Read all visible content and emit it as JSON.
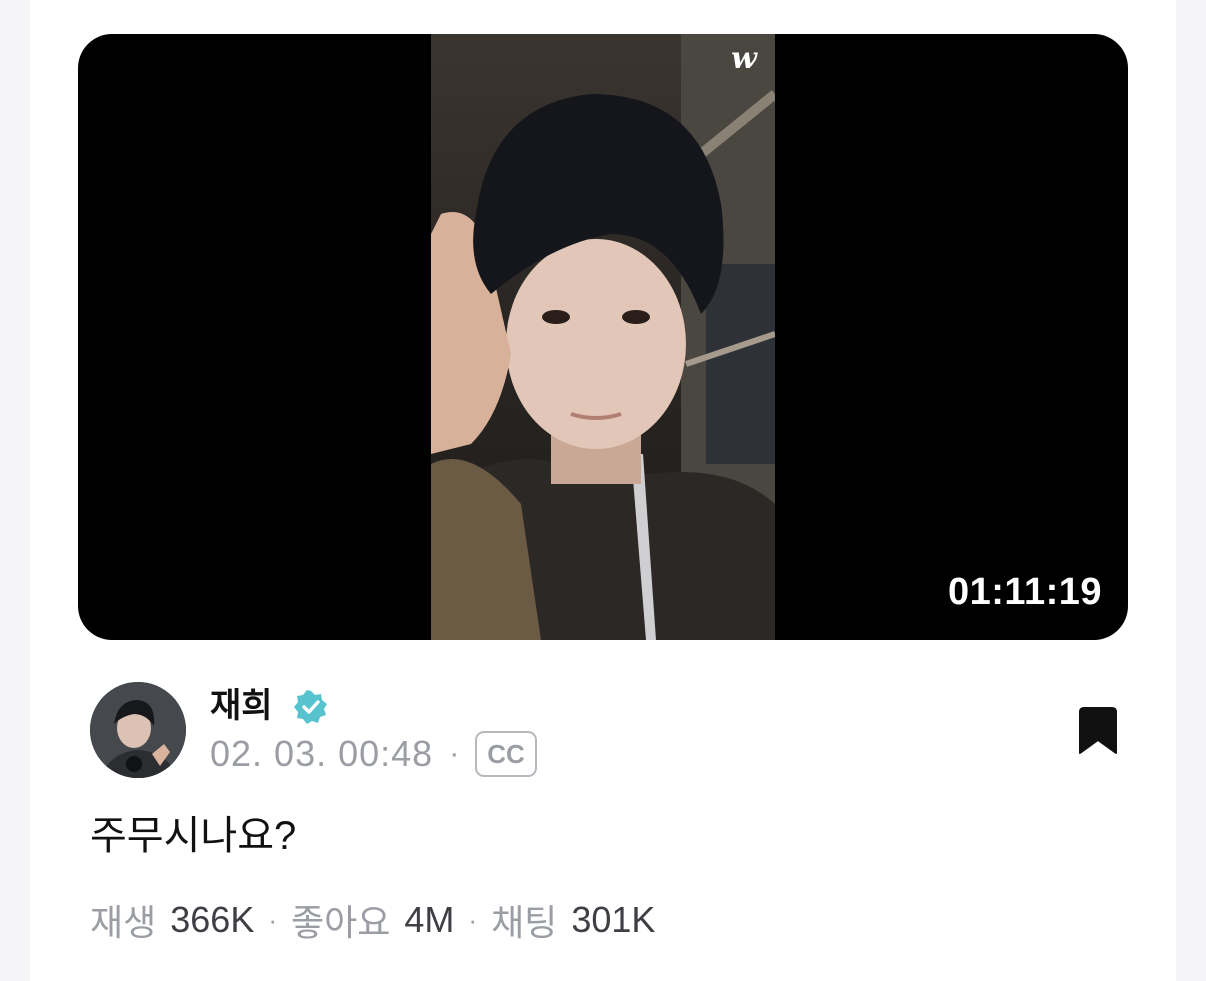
{
  "video": {
    "watermark": "w",
    "duration": "01:11:19"
  },
  "author": {
    "name": "재희",
    "date": "02. 03. 00:48",
    "separator": "·",
    "cc_label": "CC"
  },
  "post": {
    "title": "주무시나요?"
  },
  "stats": {
    "plays_label": "재생",
    "plays_value": "366K",
    "likes_label": "좋아요",
    "likes_value": "4M",
    "chats_label": "채팅",
    "chats_value": "301K",
    "separator": "·"
  },
  "colors": {
    "verified_badge": "#56c3cf",
    "muted_text": "#9a9da3",
    "primary_text": "#111111"
  },
  "icons": {
    "verified": "verified-badge-icon",
    "bookmark": "bookmark-icon"
  }
}
